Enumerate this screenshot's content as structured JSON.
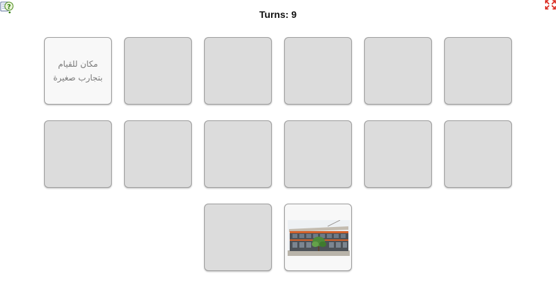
{
  "header": {
    "turns_label": "Turns: 9",
    "help_icon": "help-question-icon",
    "fullscreen_icon": "fullscreen-expand-icon"
  },
  "cards": [
    {
      "state": "face-up",
      "text": "مكان للقيام بتجارب صغيرة"
    },
    {
      "state": "face-down"
    },
    {
      "state": "face-down"
    },
    {
      "state": "face-down"
    },
    {
      "state": "face-down"
    },
    {
      "state": "face-down"
    },
    {
      "state": "face-down"
    },
    {
      "state": "face-down"
    },
    {
      "state": "face-down"
    },
    {
      "state": "face-down"
    },
    {
      "state": "face-down"
    },
    {
      "state": "face-down"
    },
    {
      "state": "face-down"
    },
    {
      "state": "face-up",
      "image": "building-photo"
    }
  ],
  "colors": {
    "card_back": "#dcdcdc",
    "card_face": "#f8f8f8",
    "card_border": "#9d9d9d"
  }
}
